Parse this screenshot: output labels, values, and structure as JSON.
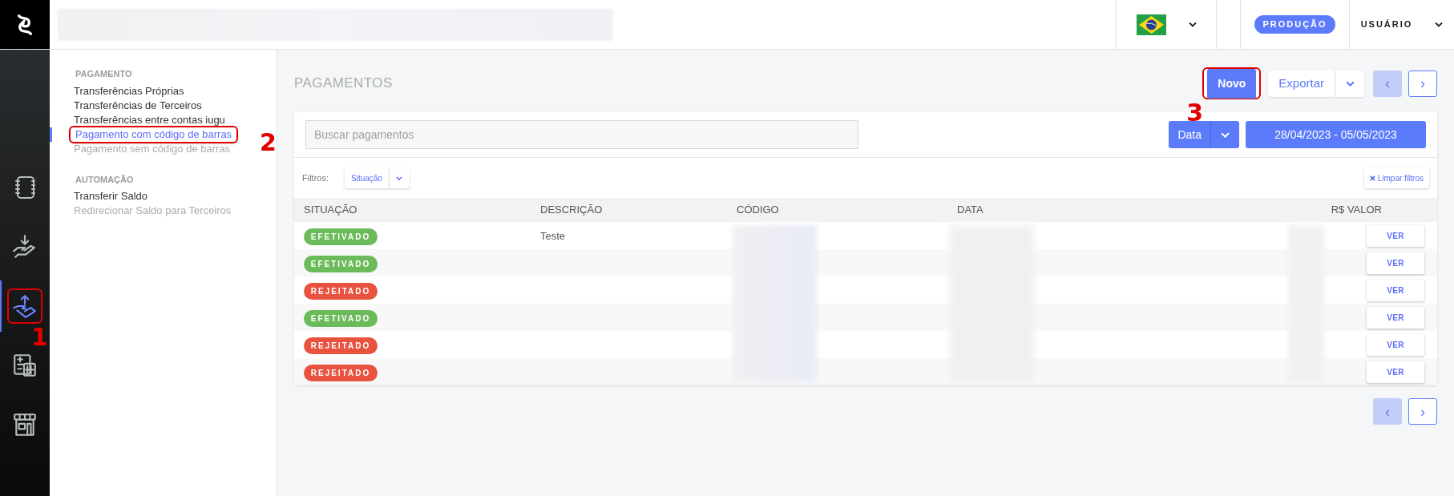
{
  "topbar": {
    "environment_badge": "PRODUÇÃO",
    "user_menu": "USUÁRIO"
  },
  "rail": [
    {
      "selected": false
    },
    {
      "selected": false
    },
    {
      "selected": true,
      "annotation": "1"
    },
    {
      "selected": false
    },
    {
      "selected": false
    }
  ],
  "submenu": [
    {
      "heading": "PAGAMENTO",
      "items": [
        {
          "label": "Transferências Próprias",
          "selected": false,
          "disabled": false
        },
        {
          "label": "Transferências de Terceiros",
          "selected": false,
          "disabled": false
        },
        {
          "label": "Transferências entre contas iugu",
          "selected": false,
          "disabled": false
        },
        {
          "label": "Pagamento com código de barras",
          "selected": true,
          "disabled": false,
          "annotation": "2"
        },
        {
          "label": "Pagamento sem código de barras",
          "selected": false,
          "disabled": true
        }
      ]
    },
    {
      "heading": "AUTOMAÇÃO",
      "items": [
        {
          "label": "Transferir Saldo",
          "selected": false,
          "disabled": false
        },
        {
          "label": "Redirecionar Saldo para Terceiros",
          "selected": false,
          "disabled": true
        }
      ]
    }
  ],
  "page_title": "PAGAMENTOS",
  "actions": {
    "new_button": {
      "label": "Novo",
      "annotation": "3"
    },
    "export_button": "Exportar",
    "pager": [
      {
        "label": "‹",
        "disabled": true
      },
      {
        "label": "›",
        "disabled": false
      }
    ]
  },
  "search": {
    "placeholder": "Buscar pagamentos"
  },
  "date_filter": {
    "label": "Data",
    "range": "28/04/2023 - 05/05/2023"
  },
  "filters": {
    "label": "Filtros:",
    "dropdown": "Situação",
    "clear_button": "Limpar filtros"
  },
  "table": {
    "columns": [
      "SITUAÇÃO",
      "DESCRIÇÃO",
      "CÓDIGO",
      "DATA",
      "R$ VALOR"
    ],
    "rows": [
      {
        "status": "EFETIVADO",
        "color": "#6cbb5a",
        "description": "Teste",
        "action": "VER"
      },
      {
        "status": "EFETIVADO",
        "color": "#6cbb5a",
        "action": "VER"
      },
      {
        "status": "REJEITADO",
        "color": "#e8533f",
        "action": "VER"
      },
      {
        "status": "EFETIVADO",
        "color": "#6cbb5a",
        "action": "VER"
      },
      {
        "status": "REJEITADO",
        "color": "#e8533f",
        "action": "VER"
      },
      {
        "status": "REJEITADO",
        "color": "#e8533f",
        "action": "VER"
      }
    ]
  },
  "bottom_pager": [
    {
      "label": "‹",
      "disabled": true
    },
    {
      "label": "›",
      "disabled": false
    }
  ]
}
